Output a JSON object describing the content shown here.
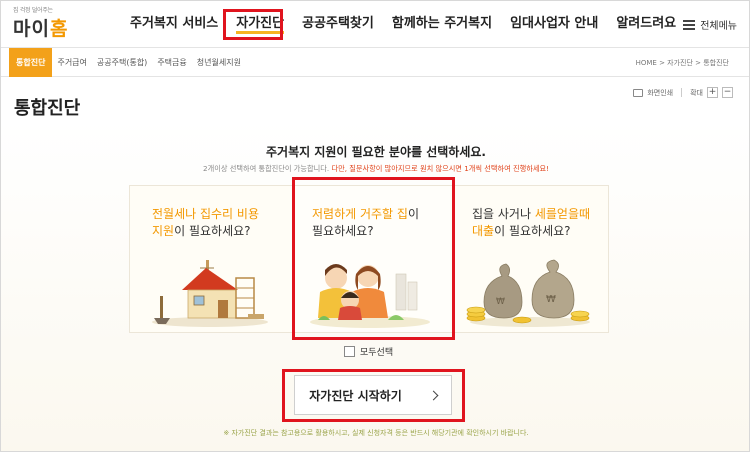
{
  "logo": {
    "tagline": "집 걱정 덜어주는",
    "name_prefix": "마이",
    "name_accent": "홈"
  },
  "gnb": [
    {
      "label": "주거복지 서비스"
    },
    {
      "label": "자가진단"
    },
    {
      "label": "공공주택찾기"
    },
    {
      "label": "함께하는 주거복지"
    },
    {
      "label": "임대사업자 안내"
    },
    {
      "label": "알려드려요"
    }
  ],
  "allmenu_label": "전체메뉴",
  "subnav": [
    {
      "label": "통합진단"
    },
    {
      "label": "주거급여"
    },
    {
      "label": "공공주택(통합)"
    },
    {
      "label": "주택금융"
    },
    {
      "label": "청년월세지원"
    }
  ],
  "breadcrumb": "HOME > 자가진단 > 통합진단",
  "page_title": "통합진단",
  "util": {
    "print_label": "화면인쇄",
    "zoom_label": "확대",
    "zoom_in": "+",
    "zoom_out": "−"
  },
  "question": {
    "title": "주거복지 지원이 필요한 분야를 선택하세요.",
    "sub_normal": "2개이상 선택하여 통합진단이 가능합니다.",
    "sub_warn": "다만, 질문사항이 많아지므로 원치 않으시면 1개씩 선택하여 진행하세요!"
  },
  "cards": [
    {
      "line1_plain": "",
      "line1_orange": "전월세나 집수리 비용",
      "line2_orange": "지원",
      "line2_plain": "이 필요하세요?",
      "illustration": "house-icon"
    },
    {
      "line1_plain": "",
      "line1_orange": "저렴하게 거주할 집",
      "line1_tail": "이",
      "line2_orange": "",
      "line2_plain": "필요하세요?",
      "illustration": "family-icon"
    },
    {
      "line1_plain": "집을 사거나 ",
      "line1_orange": "세를얻을때",
      "line2_orange": "대출",
      "line2_plain": "이 필요하세요?",
      "illustration": "money-bags-icon"
    }
  ],
  "check_all_label": "모두선택",
  "start_button_label": "자가진단 시작하기",
  "footnote": "※ 자가진단 결과는 참고용으로 활용하시고, 실제 신청자격 등은 반드시 해당기관에 확인하시기 바랍니다.",
  "colors": {
    "accent": "#f39800",
    "highlight": "#e0141e",
    "active_tab": "#f3a11a",
    "warn": "#e0431b"
  }
}
